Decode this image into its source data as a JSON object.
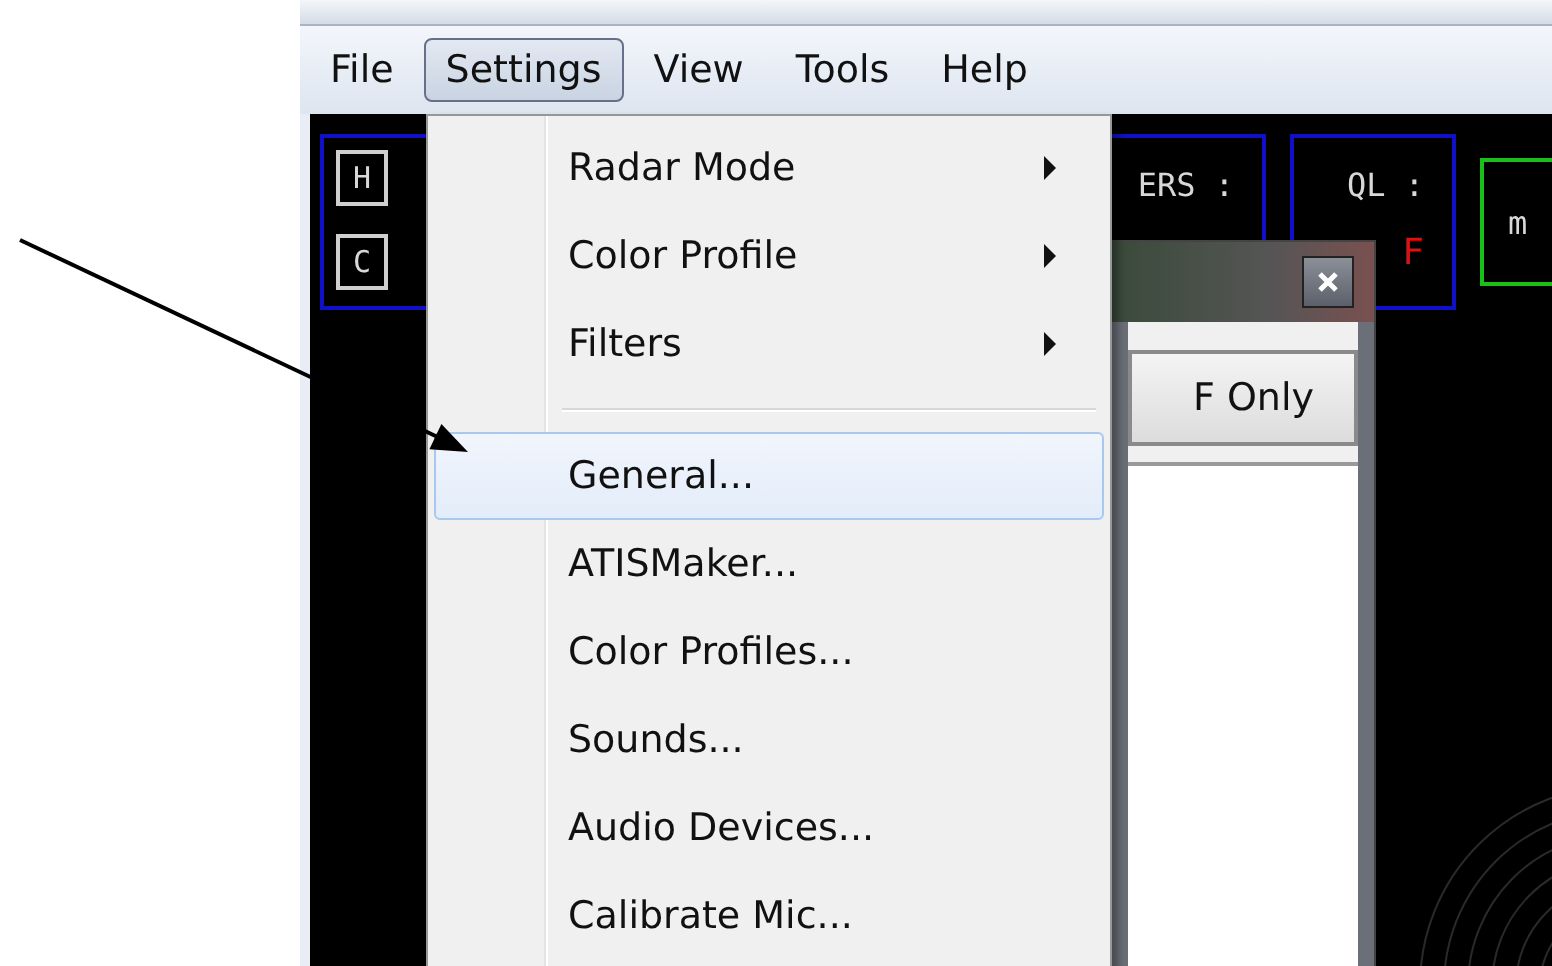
{
  "menu_bar": [
    {
      "label": "File",
      "selected": false
    },
    {
      "label": "Settings",
      "selected": true
    },
    {
      "label": "View",
      "selected": false
    },
    {
      "label": "Tools",
      "selected": false
    },
    {
      "label": "Help",
      "selected": false
    }
  ],
  "settings_menu": {
    "items": [
      {
        "kind": "submenu",
        "label": "Radar Mode",
        "selected": false
      },
      {
        "kind": "submenu",
        "label": "Color Profile",
        "selected": false
      },
      {
        "kind": "submenu",
        "label": "Filters",
        "selected": false
      },
      {
        "kind": "separator"
      },
      {
        "kind": "command",
        "label": "General...",
        "selected": true
      },
      {
        "kind": "command",
        "label": "ATISMaker...",
        "selected": false
      },
      {
        "kind": "command",
        "label": "Color Profiles...",
        "selected": false
      },
      {
        "kind": "command",
        "label": "Sounds...",
        "selected": false
      },
      {
        "kind": "command",
        "label": "Audio Devices...",
        "selected": false
      },
      {
        "kind": "command",
        "label": "Calibrate Mic...",
        "selected": false
      }
    ]
  },
  "radar_panel": {
    "keys": [
      "H",
      "C"
    ],
    "counter_label": "ERS :",
    "queue": {
      "label": "QL :",
      "value": "F"
    },
    "green_box_text": "m"
  },
  "dialog": {
    "button": "F Only"
  }
}
